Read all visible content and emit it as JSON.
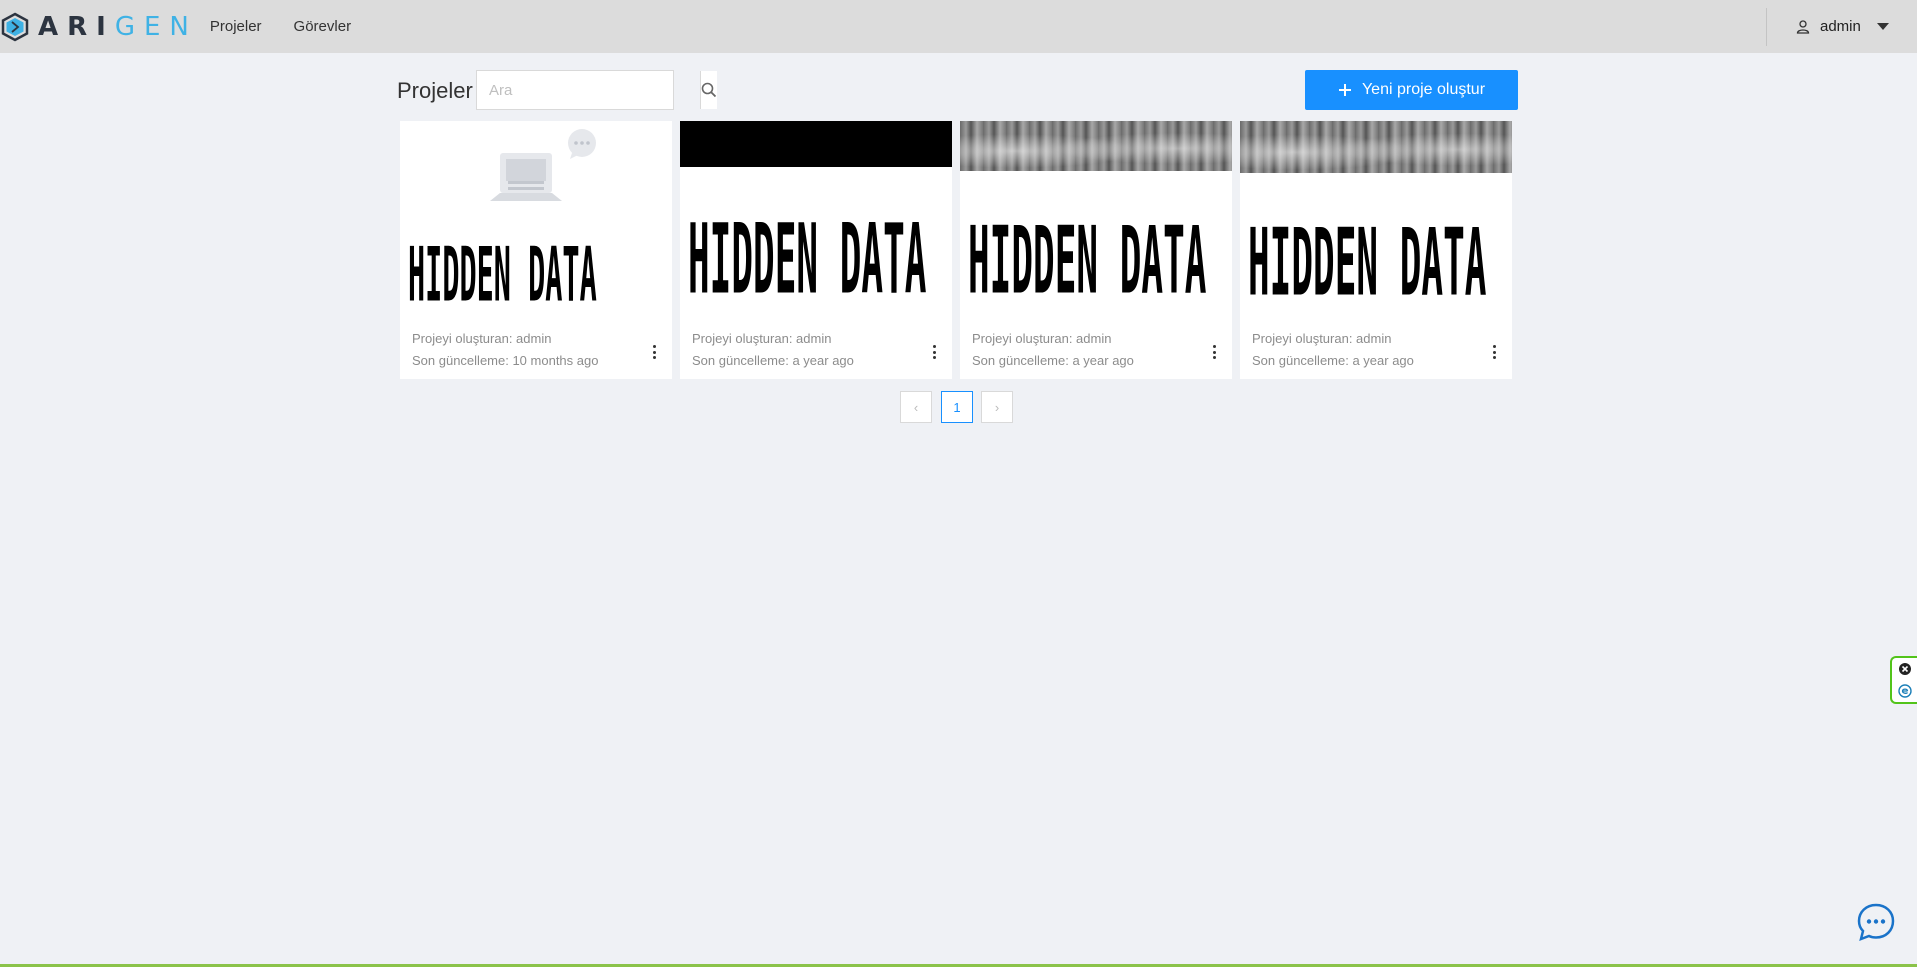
{
  "header": {
    "logo_dark": "ARI",
    "logo_light": "GEN",
    "nav": [
      {
        "label": "Projeler"
      },
      {
        "label": "Görevler"
      }
    ],
    "user": {
      "name": "admin"
    }
  },
  "toolbar": {
    "title": "Projeler",
    "search_placeholder": "Ara",
    "new_project_label": "Yeni proje oluştur"
  },
  "cards": [
    {
      "title": "HIDDEN DATA",
      "creator": "Projeyi oluşturan: admin",
      "updated": "Son güncelleme: 10 months ago",
      "thumbnail": "placeholder"
    },
    {
      "title": "HIDDEN DATA",
      "creator": "Projeyi oluşturan: admin",
      "updated": "Son güncelleme: a year ago",
      "thumbnail": "black"
    },
    {
      "title": "HIDDEN DATA",
      "creator": "Projeyi oluşturan: admin",
      "updated": "Son güncelleme: a year ago",
      "thumbnail": "x-ray"
    },
    {
      "title": "HIDDEN DATA",
      "creator": "Projeyi oluşturan: admin",
      "updated": "Son güncelleme: a year ago",
      "thumbnail": "x-ray"
    }
  ],
  "pagination": {
    "prev": "‹",
    "current": "1",
    "next": "›"
  },
  "colors": {
    "primary": "#1890ff",
    "logo_accent": "#3fb2e5",
    "header_bg": "#dcdcdc",
    "page_bg": "#eff1f5"
  }
}
